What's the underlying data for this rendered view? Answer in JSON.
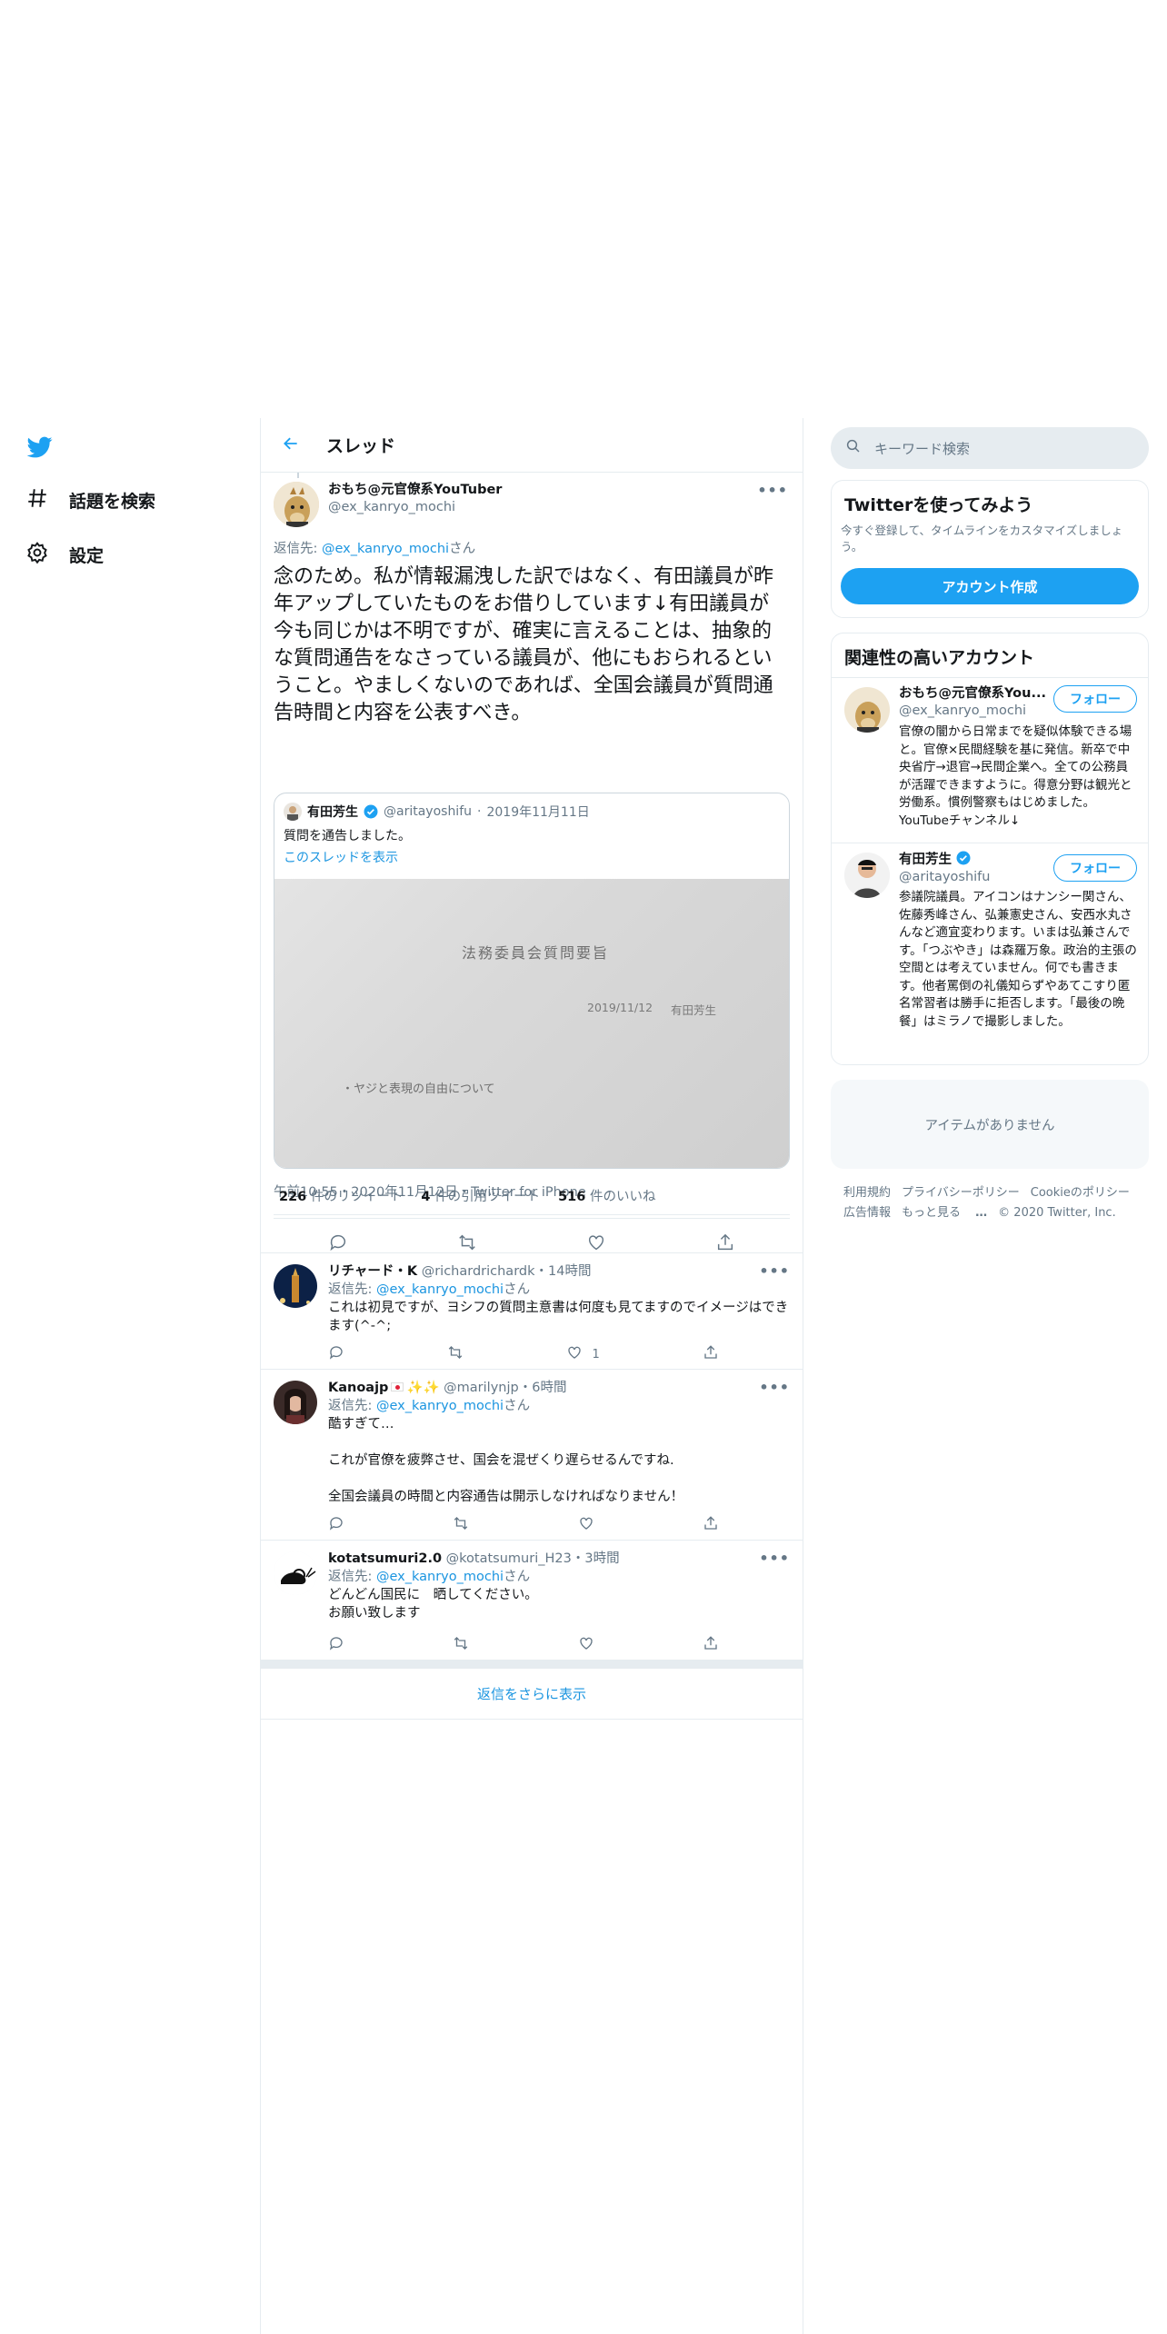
{
  "nav": {
    "explore_label": "話題を検索",
    "settings_label": "設定"
  },
  "header": {
    "title": "スレッド"
  },
  "main_tweet": {
    "author_name": "おもち@元官僚系YouTuber",
    "author_handle": "@ex_kanryo_mochi",
    "reply_to_prefix": "返信先:",
    "reply_to_handle": "@ex_kanryo_mochi",
    "reply_to_suffix": "さん",
    "text": "念のため。私が情報漏洩した訳ではなく、有田議員が昨年アップしていたものをお借りしています↓有田議員が今も同じかは不明ですが、確実に言えることは、抽象的な質問通告をなさっている議員が、他にもおられるということ。やましくないのであれば、全国会議員が質問通告時間と内容を公表すべき。",
    "quote": {
      "author_name": "有田芳生",
      "author_handle": "@aritayoshifu",
      "date": "2019年11月11日",
      "text": "質問を通告しました。",
      "thread_link": "このスレッドを表示",
      "image_title": "法務委員会質問要旨",
      "image_date": "2019/11/12",
      "image_author": "有田芳生",
      "image_item": "・ヤジと表現の自由について"
    },
    "timestamp": "午前10:55・2020年11月12日・Twitter for iPhone",
    "stats": {
      "retweets_count": "226",
      "retweets_label": "件のリツイート",
      "quotes_count": "4",
      "quotes_label": "件の引用ツイート",
      "likes_count": "516",
      "likes_label": "件のいいね"
    }
  },
  "replies": [
    {
      "name": "リチャード・K",
      "handle": "@richardrichardk",
      "time": "・14時間",
      "reply_prefix": "返信先:",
      "reply_handle": "@ex_kanryo_mochi",
      "reply_suffix": "さん",
      "text": "これは初見ですが、ヨシフの質問主意書は何度も見てますのでイメージはできます(^-^;",
      "like_count": "1"
    },
    {
      "name": "Kanoajp",
      "handle": "@marilynjp",
      "time": "・6時間",
      "reply_prefix": "返信先:",
      "reply_handle": "@ex_kanryo_mochi",
      "reply_suffix": "さん",
      "text_line1": "酷すぎて…",
      "text_line2": "これが官僚を疲弊させ、国会を混ぜくり遅らせるんですね.",
      "text_line3": "全国会議員の時間と内容通告は開示しなければなりません！"
    },
    {
      "name": "kotatsumuri2.0",
      "handle": "@kotatsumuri_H23",
      "time": "・3時間",
      "reply_prefix": "返信先:",
      "reply_handle": "@ex_kanryo_mochi",
      "reply_suffix": "さん",
      "text_line1": "どんどん国民に　晒してください。",
      "text_line2": "お願い致します"
    }
  ],
  "show_more_replies": "返信をさらに表示",
  "sidebar": {
    "search_placeholder": "キーワード検索",
    "signup": {
      "title": "Twitterを使ってみよう",
      "subtitle": "今すぐ登録して、タイムラインをカスタマイズしましょう。",
      "button": "アカウント作成"
    },
    "related": {
      "title": "関連性の高いアカウント",
      "accounts": [
        {
          "name": "おもち@元官僚系You...",
          "handle": "@ex_kanryo_mochi",
          "follow": "フォロー",
          "bio": "官僚の闇から日常までを疑似体験できる場と。官僚×民間経験を基に発信。新卒で中央省庁→退官→民間企業へ。全ての公務員が活躍できますように。得意分野は観光と労働系。慣例警察もはじめました。YouTubeチャンネル↓"
        },
        {
          "name": "有田芳生",
          "handle": "@aritayoshifu",
          "follow": "フォロー",
          "bio": "参議院議員。アイコンはナンシー関さん、佐藤秀峰さん、弘兼憲史さん、安西水丸さんなど適宜変わります。いまは弘兼さんです。「つぶやき」は森羅万象。政治的主張の空間とは考えていません。何でも書きます。他者罵倒の礼儀知らずやあてこすり匿名常習者は勝手に拒否します。「最後の晩餐」はミラノで撮影しました。"
        }
      ]
    },
    "trends_empty": "アイテムがありません",
    "footer": {
      "terms": "利用規約",
      "privacy": "プライバシーポリシー",
      "cookie": "Cookieのポリシー",
      "ads": "広告情報",
      "more": "もっと見る",
      "copyright": "© 2020 Twitter, Inc."
    }
  },
  "colors": {
    "accent": "#1da1f2",
    "link": "#1b95e0",
    "muted": "#657786",
    "border": "#e6ecf0"
  }
}
